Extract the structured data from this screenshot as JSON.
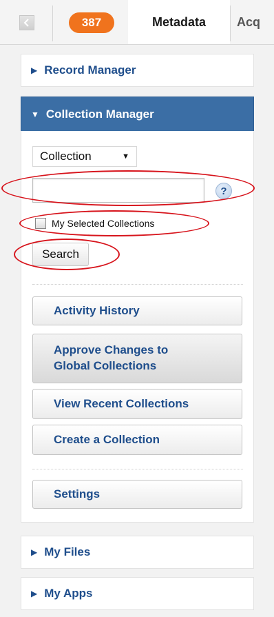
{
  "tabs": {
    "collapse_icon": "chevron-left-icon",
    "badge_count": "387",
    "active_tab": "Metadata",
    "next_tab": "Acq"
  },
  "panels": {
    "record_manager": "Record Manager",
    "collection_manager": "Collection Manager",
    "my_files": "My Files",
    "my_apps": "My Apps"
  },
  "collection_manager": {
    "search_type": "Collection",
    "search_value": "",
    "help_label": "?",
    "my_selected_label": "My Selected Collections",
    "my_selected_checked": false,
    "search_button": "Search",
    "actions": {
      "activity_history": "Activity History",
      "approve_line1": "Approve Changes to",
      "approve_line2": "Global Collections",
      "view_recent": "View Recent Collections",
      "create": "Create a Collection",
      "settings": "Settings"
    }
  },
  "colors": {
    "accent": "#3b6ea5",
    "link_text": "#1f4e8c",
    "badge": "#f0731d",
    "annotation": "#d7141c"
  }
}
